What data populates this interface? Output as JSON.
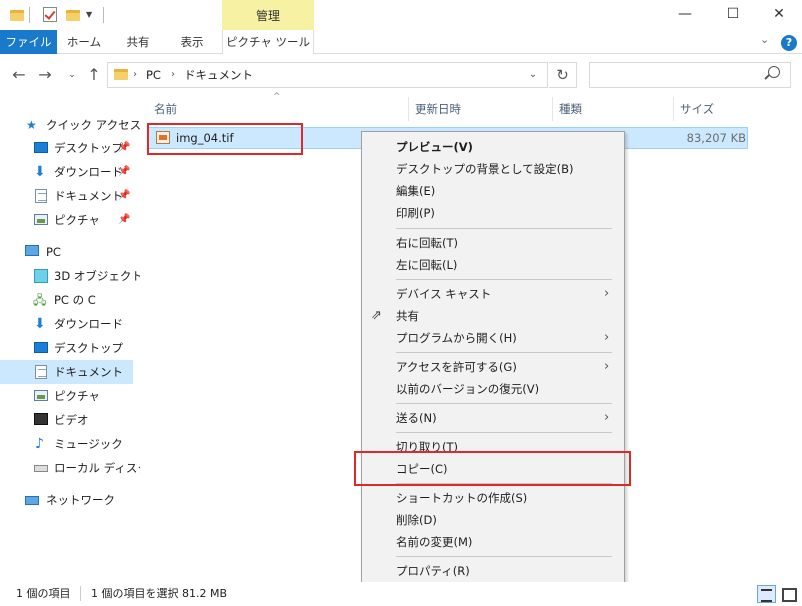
{
  "ribbon": {
    "context_header": "管理",
    "tabs": {
      "file": "ファイル",
      "home": "ホーム",
      "share": "共有",
      "view": "表示",
      "picture_tools": "ピクチャ ツール"
    },
    "help": "?"
  },
  "address": {
    "crumbs": [
      "PC",
      "ドキュメント"
    ]
  },
  "nav": {
    "quick_access": "クイック アクセス",
    "desktop": "デスクトップ",
    "downloads": "ダウンロード",
    "documents": "ドキュメント",
    "pictures": "ピクチャ",
    "pc": "PC",
    "objects3d": "3D オブジェクト",
    "pc_c": "PC の C",
    "downloads2": "ダウンロード",
    "desktop2": "デスクトップ",
    "documents2": "ドキュメント",
    "pictures2": "ピクチャ",
    "videos": "ビデオ",
    "music": "ミュージック",
    "local_disk": "ローカル ディスク",
    "network": "ネットワーク"
  },
  "columns": {
    "name": "名前",
    "date": "更新日時",
    "type": "種類",
    "size": "サイズ"
  },
  "file": {
    "name": "img_04.tif",
    "size": "83,207 KB"
  },
  "menu": {
    "preview": "プレビュー(V)",
    "set_background": "デスクトップの背景として設定(B)",
    "edit": "編集(E)",
    "print": "印刷(P)",
    "rotate_right": "右に回転(T)",
    "rotate_left": "左に回転(L)",
    "cast": "デバイス キャスト",
    "share": "共有",
    "open_with": "プログラムから開く(H)",
    "give_access": "アクセスを許可する(G)",
    "restore": "以前のバージョンの復元(V)",
    "send_to": "送る(N)",
    "cut": "切り取り(T)",
    "copy": "コピー(C)",
    "create_shortcut": "ショートカットの作成(S)",
    "delete": "削除(D)",
    "rename": "名前の変更(M)",
    "properties": "プロパティ(R)"
  },
  "status": {
    "count": "1 個の項目",
    "selected": "1 個の項目を選択 81.2 MB"
  },
  "colors": {
    "accent": "#1979ca",
    "context_tab": "#f7f1a4",
    "selection": "#cce8ff",
    "highlight_red": "#e02828"
  }
}
